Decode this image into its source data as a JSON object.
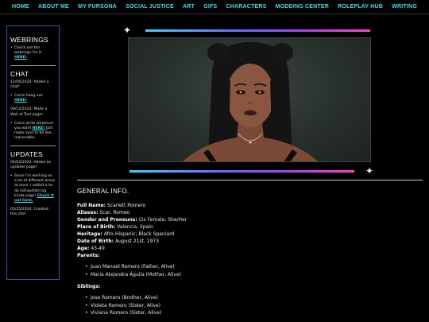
{
  "nav": {
    "items": [
      "HOME",
      "ABOUT ME",
      "MY FURSONA",
      "SOCIAL JUSTICE",
      "ART",
      "GIFS",
      "CHARACTERS",
      "MODDING CENTER",
      "ROLEPLAY HUB",
      "WRITING"
    ]
  },
  "sidebar": {
    "webrings": {
      "title": "WEBRINGS",
      "item_text": "Check out the webrings I'm in",
      "item_link": "HERE!"
    },
    "chat": {
      "title": "CHAT",
      "entry1": "12/06/2024: Added a chat!",
      "item1_text": "Come hang out",
      "item1_link": "HERE!",
      "entry2": "09/12/2024: Made a Wall of Text page!",
      "item2_text": "Come write whatever you want",
      "item2_link": "HERE!",
      "item2_tail": "Just make sure to be like... reasonable."
    },
    "updates": {
      "title": "UPDATES",
      "entry1": "05/02/2024: Added an updates page!",
      "item1_text": "Since I'm working on a lot of different areas at once, I added a to-do list/update log kinda page!",
      "item1_link": "Check it out here.",
      "entry2": "01/25/2024: Created this site!"
    }
  },
  "header": {
    "sparkle_glyph": "✦",
    "gradient_colors": [
      "#3ad0ff",
      "#6a6cff",
      "#b03cf0",
      "#ff40c8"
    ]
  },
  "main": {
    "section_title": "GENERAL INFO.",
    "fields": [
      {
        "label": "Full Name:",
        "value": "Scarlett Romero"
      },
      {
        "label": "Aliases:",
        "value": "Scar, Romeo"
      },
      {
        "label": "Gender and Pronouns:",
        "value": "Cis Female; She/Her"
      },
      {
        "label": "Place of Birth:",
        "value": "Valencia, Spain"
      },
      {
        "label": "Heritage:",
        "value": "Afro-Hispanic; Black Spaniard"
      },
      {
        "label": "Date of Birth:",
        "value": "August 21st, 1973"
      },
      {
        "label": "Age:",
        "value": "43-49"
      },
      {
        "label": "Parents:",
        "value": ""
      }
    ],
    "parents": [
      "Juan Manuel Romero (Father, Alive)",
      "Maria Alejandra Águila (Mother, Alive)"
    ],
    "siblings_label": "Siblings:",
    "siblings": [
      "Jose Romero (Brother, Alive)",
      "Violeta Romero (Sister, Alive)",
      "Viviana Romero (Sister, Alive)"
    ]
  },
  "colors": {
    "accent": "#2fe0f0",
    "sidebar_border": "#5a3aa8",
    "background": "#000000"
  }
}
